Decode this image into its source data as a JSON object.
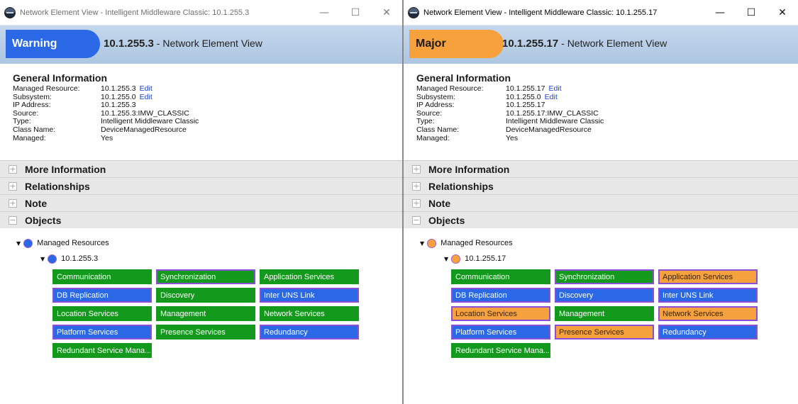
{
  "colors": {
    "warning": "#2b68e6",
    "major": "#f7a13c",
    "ok": "#139a1c"
  },
  "windows": [
    {
      "title": "Network Element View - Intelligent Middleware Classic: 10.1.255.3",
      "controls": {
        "minimize": "—",
        "maximize": "☐",
        "close": "✕"
      },
      "severity": "Warning",
      "severity_color": "#2b68e6",
      "header_ip": "10.1.255.3",
      "header_suffix": " - Network Element View",
      "general_heading": "General Information",
      "info": [
        {
          "label": "Managed Resource:",
          "value": "10.1.255.3",
          "edit": "Edit"
        },
        {
          "label": "Subsystem:",
          "value": "10.1.255.0",
          "edit": "Edit"
        },
        {
          "label": "IP Address:",
          "value": "10.1.255.3"
        },
        {
          "label": "Source:",
          "value": "10.1.255.3:IMW_CLASSIC"
        },
        {
          "label": "Type:",
          "value": "Intelligent Middleware Classic"
        },
        {
          "label": "Class Name:",
          "value": "DeviceManagedResource"
        },
        {
          "label": "Managed:",
          "value": "Yes"
        }
      ],
      "sections": [
        {
          "label": "More Information",
          "toggle": "+"
        },
        {
          "label": "Relationships",
          "toggle": "+"
        },
        {
          "label": "Note",
          "toggle": "+"
        },
        {
          "label": "Objects",
          "toggle": "−"
        }
      ],
      "tree": {
        "root_label": "Managed Resources",
        "root_status": "warning",
        "child_label": "10.1.255.3",
        "child_status": "warning",
        "expander": "▼"
      },
      "services": [
        {
          "label": "Communication",
          "status": "ok"
        },
        {
          "label": "Synchronization",
          "status": "ok-outlined"
        },
        {
          "label": "Application Services",
          "status": "ok"
        },
        {
          "label": "DB Replication",
          "status": "warning"
        },
        {
          "label": "Discovery",
          "status": "ok"
        },
        {
          "label": "Inter UNS Link",
          "status": "warning"
        },
        {
          "label": "Location Services",
          "status": "ok"
        },
        {
          "label": "Management",
          "status": "ok"
        },
        {
          "label": "Network Services",
          "status": "ok"
        },
        {
          "label": "Platform Services",
          "status": "warning"
        },
        {
          "label": "Presence Services",
          "status": "ok"
        },
        {
          "label": "Redundancy",
          "status": "warning"
        },
        {
          "label": "Redundant Service Mana...",
          "status": "ok"
        }
      ]
    },
    {
      "title": "Network Element View - Intelligent Middleware Classic: 10.1.255.17",
      "controls": {
        "minimize": "—",
        "maximize": "☐",
        "close": "✕"
      },
      "severity": "Major",
      "severity_color": "#f7a13c",
      "header_ip": "10.1.255.17",
      "header_suffix": " - Network Element View",
      "general_heading": "General Information",
      "info": [
        {
          "label": "Managed Resource:",
          "value": "10.1.255.17",
          "edit": "Edit"
        },
        {
          "label": "Subsystem:",
          "value": "10.1.255.0",
          "edit": "Edit"
        },
        {
          "label": "IP Address:",
          "value": "10.1.255.17"
        },
        {
          "label": "Source:",
          "value": "10.1.255.17:IMW_CLASSIC"
        },
        {
          "label": "Type:",
          "value": "Intelligent Middleware Classic"
        },
        {
          "label": "Class Name:",
          "value": "DeviceManagedResource"
        },
        {
          "label": "Managed:",
          "value": "Yes"
        }
      ],
      "sections": [
        {
          "label": "More Information",
          "toggle": "+"
        },
        {
          "label": "Relationships",
          "toggle": "+"
        },
        {
          "label": "Note",
          "toggle": "+"
        },
        {
          "label": "Objects",
          "toggle": "−"
        }
      ],
      "tree": {
        "root_label": "Managed Resources",
        "root_status": "major",
        "child_label": "10.1.255.17",
        "child_status": "major",
        "expander": "▼"
      },
      "services": [
        {
          "label": "Communication",
          "status": "ok"
        },
        {
          "label": "Synchronization",
          "status": "ok-outlined"
        },
        {
          "label": "Application Services",
          "status": "major"
        },
        {
          "label": "DB Replication",
          "status": "warning"
        },
        {
          "label": "Discovery",
          "status": "warning"
        },
        {
          "label": "Inter UNS Link",
          "status": "warning"
        },
        {
          "label": "Location Services",
          "status": "major"
        },
        {
          "label": "Management",
          "status": "ok"
        },
        {
          "label": "Network Services",
          "status": "major"
        },
        {
          "label": "Platform Services",
          "status": "warning"
        },
        {
          "label": "Presence Services",
          "status": "major"
        },
        {
          "label": "Redundancy",
          "status": "warning"
        },
        {
          "label": "Redundant Service Mana...",
          "status": "ok"
        }
      ]
    }
  ]
}
